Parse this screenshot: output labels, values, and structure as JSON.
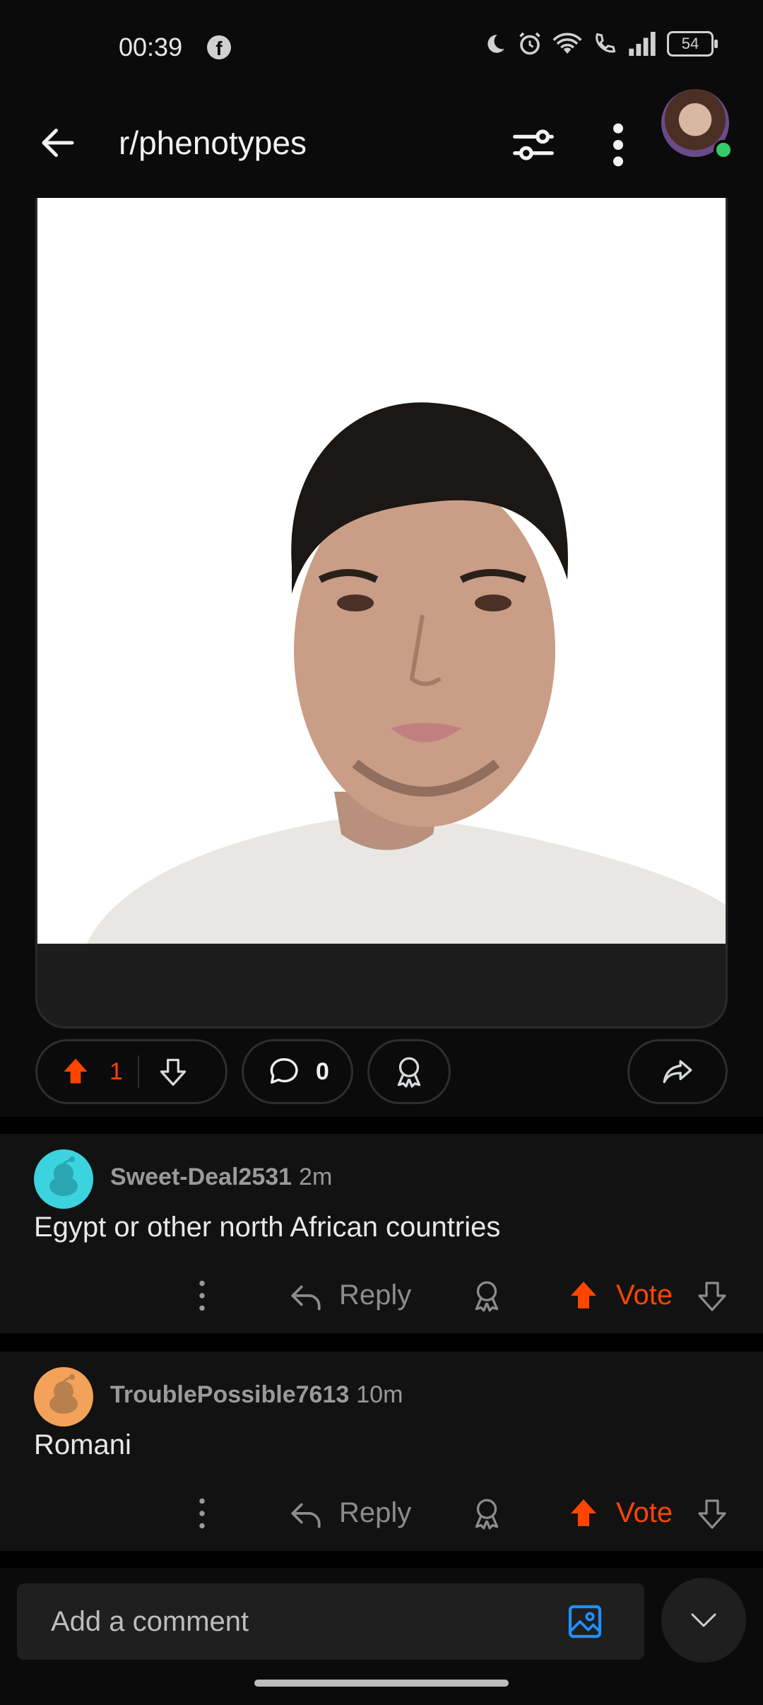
{
  "status_bar": {
    "time": "00:39",
    "battery": "54",
    "app_badge": "f"
  },
  "header": {
    "title": "r/phenotypes"
  },
  "post": {
    "image_alt": "Selfie of a young man with dark hair wearing a white t-shirt on a white background",
    "upvotes": "1",
    "comments": "0"
  },
  "comments": [
    {
      "user": "Sweet-Deal2531",
      "time": "2m",
      "text": "Egypt or other north African countries",
      "reply_label": "Reply",
      "vote_label": "Vote",
      "avatar_color": "#3bd3e0"
    },
    {
      "user": "TroublePossible7613",
      "time": "10m",
      "text": "Romani",
      "reply_label": "Reply",
      "vote_label": "Vote",
      "avatar_color": "#f4a15a"
    }
  ],
  "composer": {
    "placeholder": "Add a comment"
  },
  "colors": {
    "accent": "#ff4500",
    "bg": "#0b0b0b",
    "card": "#121212",
    "link": "#1e90ff"
  }
}
